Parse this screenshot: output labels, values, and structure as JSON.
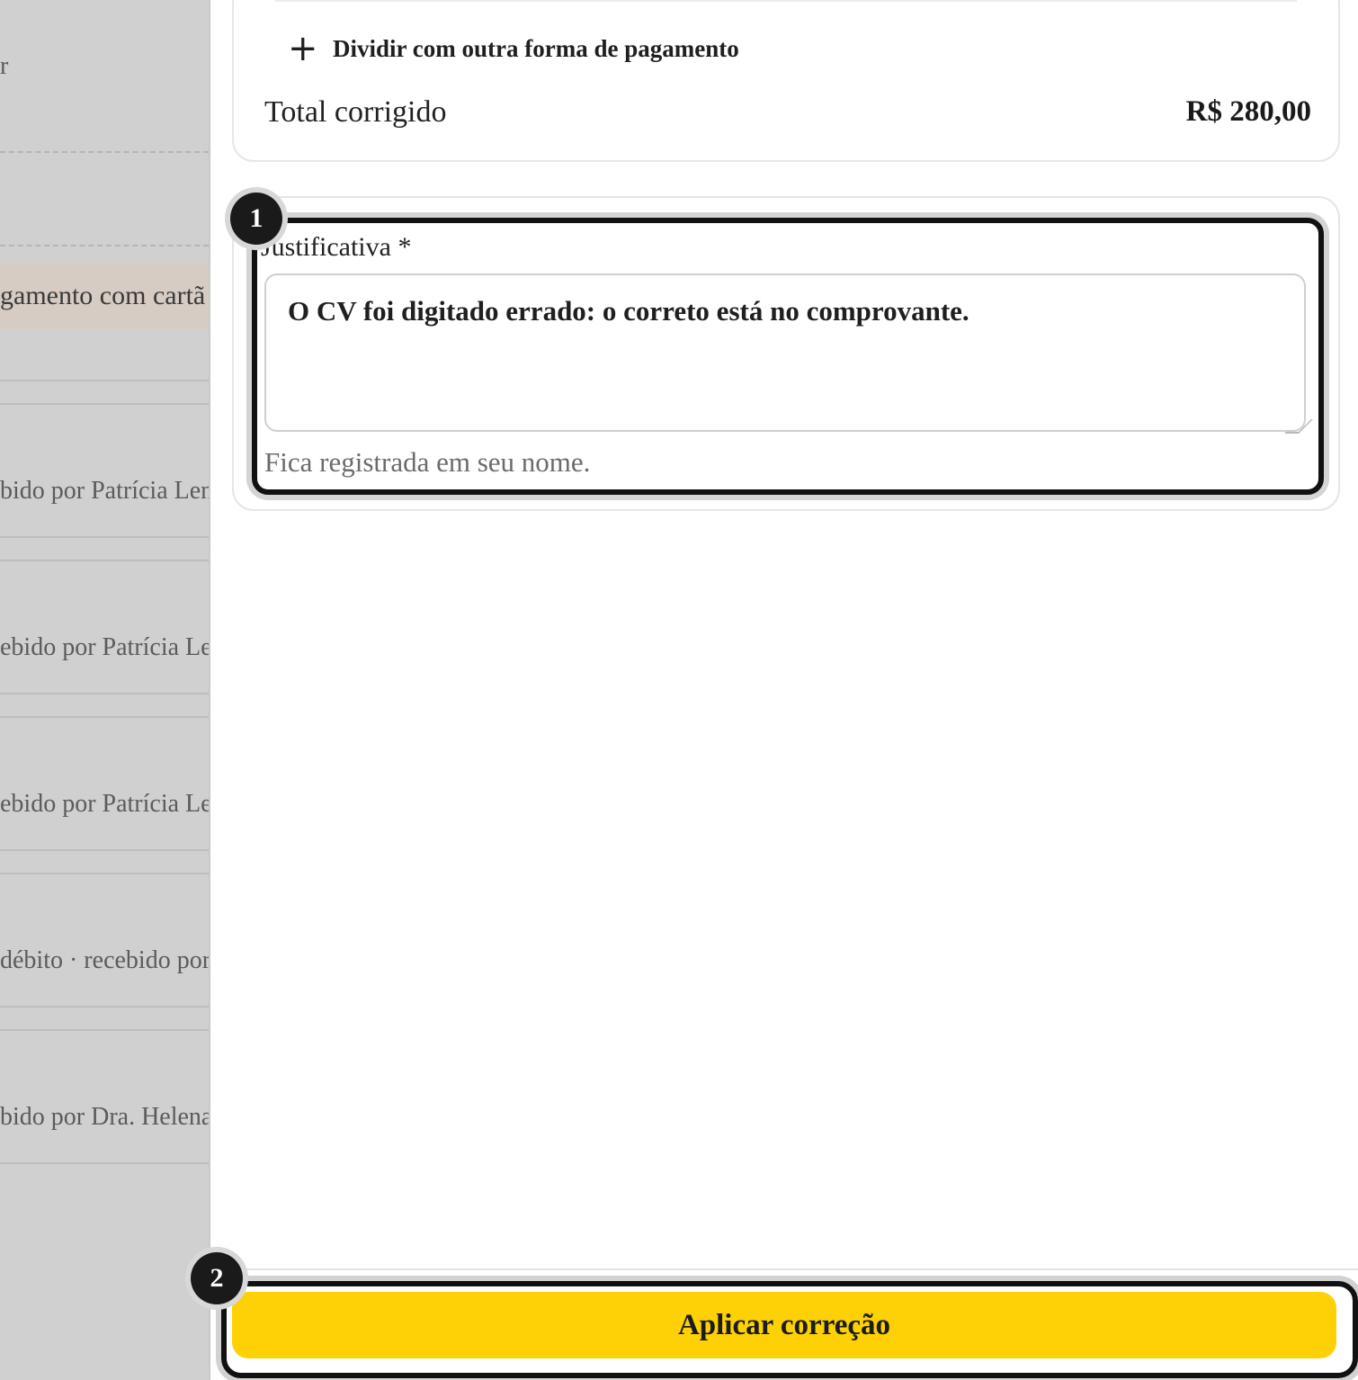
{
  "background_list": {
    "fragments": [
      "r",
      "gamento com cartã",
      "bido por Patrícia Len",
      "ebido por Patrícia Len",
      "ebido por Patrícia Len",
      "débito · recebido por",
      "bido por Dra. Helena"
    ]
  },
  "payment": {
    "split_label": "Dividir com outra forma de pagamento",
    "total_label": "Total corrigido",
    "total_value": "R$ 280,00"
  },
  "justification": {
    "label": "Justificativa *",
    "value": "O CV foi digitado errado: o correto está no comprovante.",
    "hint": "Fica registrada em seu nome."
  },
  "footer": {
    "apply_label": "Aplicar correção"
  },
  "badges": {
    "first": "1",
    "second": "2"
  },
  "colors": {
    "accent": "#fdd106",
    "focus": "#111111",
    "dim_overlay": "#d0d0d0"
  }
}
